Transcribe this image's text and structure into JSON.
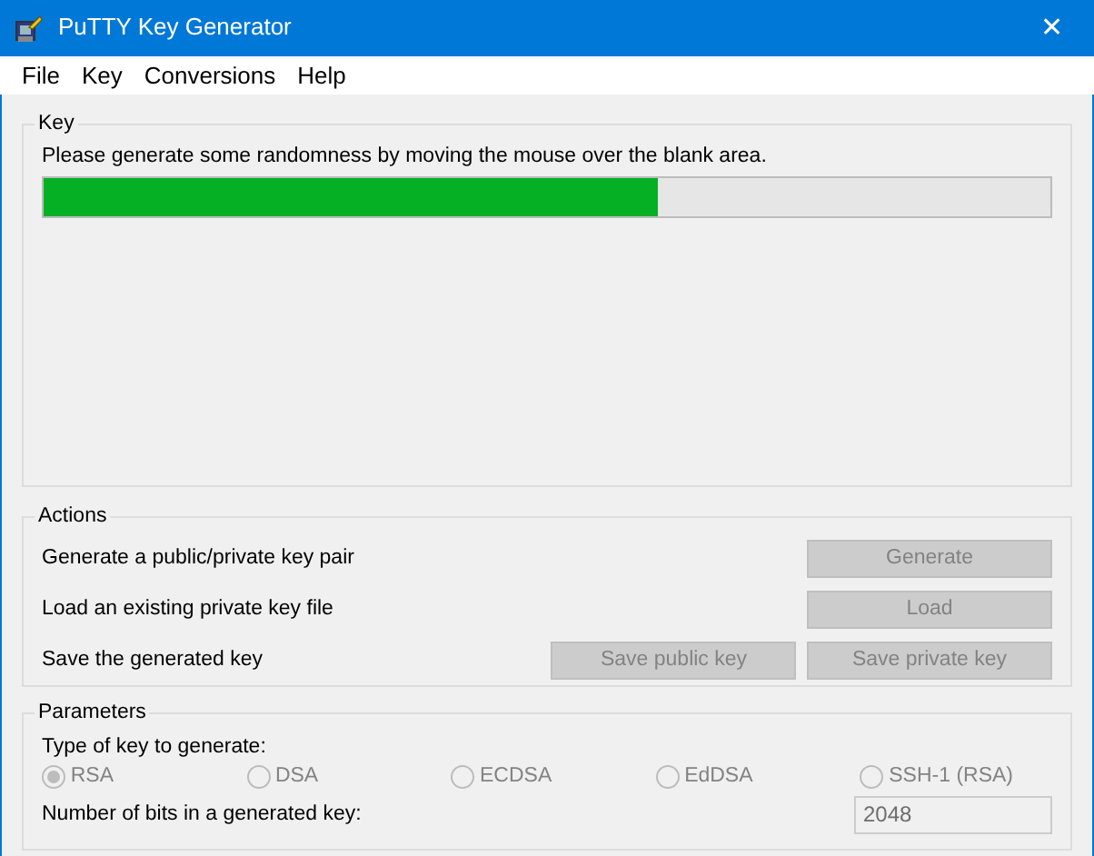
{
  "window": {
    "title": "PuTTY Key Generator",
    "close": "✕"
  },
  "menu": [
    {
      "label": "File"
    },
    {
      "label": "Key"
    },
    {
      "label": "Conversions"
    },
    {
      "label": "Help"
    }
  ],
  "key_group": {
    "title": "Key",
    "message": "Please generate some randomness by moving the mouse over the blank area.",
    "progress": {
      "level": 0.61
    }
  },
  "actions": {
    "title": "Actions",
    "rows": [
      {
        "label": "Generate a public/private key pair",
        "buttons": [
          {
            "label": "Generate",
            "disabled": true
          }
        ]
      },
      {
        "label": "Load an existing private key file",
        "buttons": [
          {
            "label": "Load",
            "disabled": true
          }
        ]
      },
      {
        "label": "Save the generated key",
        "buttons": [
          {
            "label": "Save public key",
            "disabled": true
          },
          {
            "label": "Save private key",
            "disabled": true
          }
        ]
      }
    ]
  },
  "parameters": {
    "title": "Parameters",
    "type_label": "Type of key to generate:",
    "types": [
      {
        "label": "RSA",
        "selected": true,
        "disabled": true
      },
      {
        "label": "DSA",
        "selected": false,
        "disabled": true
      },
      {
        "label": "ECDSA",
        "selected": false,
        "disabled": true
      },
      {
        "label": "EdDSA",
        "selected": false,
        "disabled": true
      },
      {
        "label": "SSH-1 (RSA)",
        "selected": false,
        "disabled": true
      }
    ],
    "bits_label": "Number of bits in a generated key:",
    "bits": {
      "value": "2048",
      "disabled": true
    }
  }
}
